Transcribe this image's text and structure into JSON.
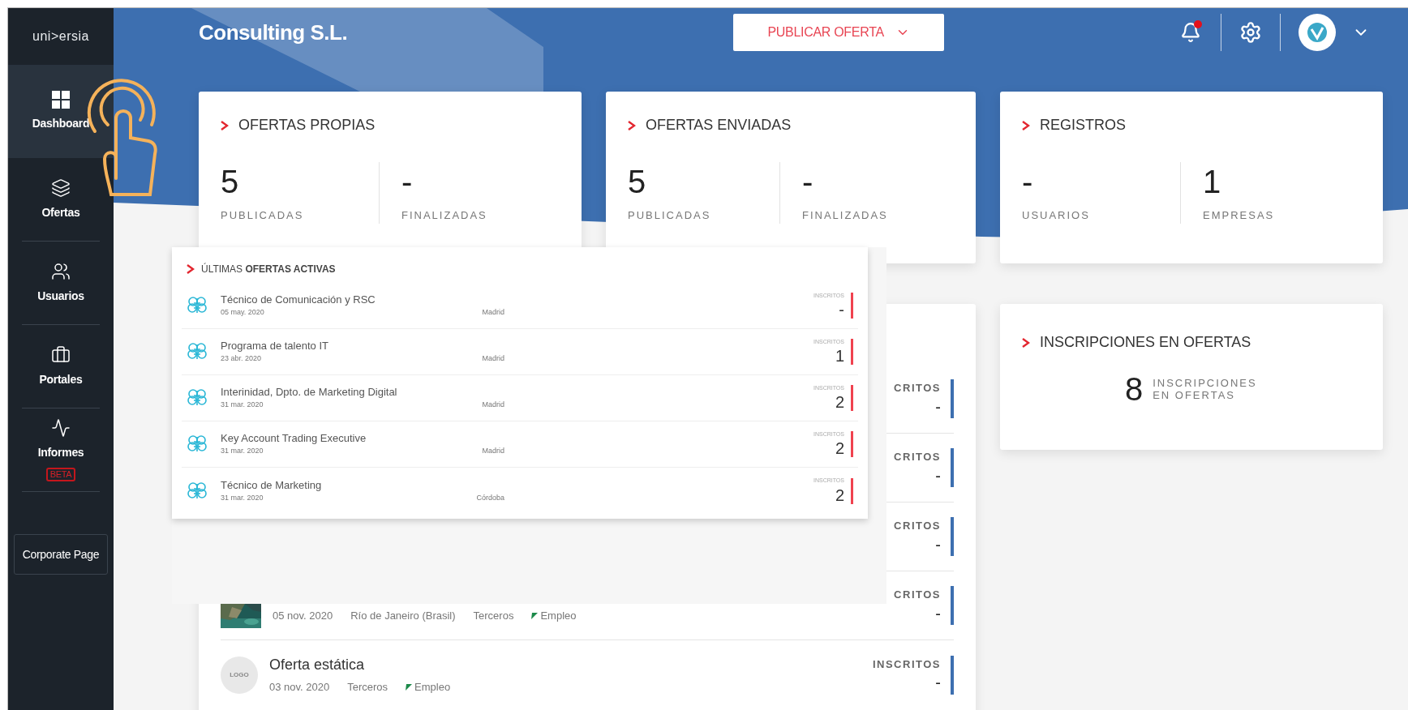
{
  "sidebar": {
    "logo": "uni>ersia",
    "items": [
      {
        "label": "Dashboard",
        "selected": true
      },
      {
        "label": "Ofertas",
        "selected": false
      },
      {
        "label": "Usuarios",
        "selected": false
      },
      {
        "label": "Portales",
        "selected": false
      },
      {
        "label": "Informes",
        "selected": false,
        "badge": "BETA"
      }
    ],
    "corporate_button": "Corporate Page"
  },
  "header": {
    "company": "Consulting S.L.",
    "publish_button": "PUBLICAR OFERTA",
    "unread_notifications": true
  },
  "stat_cards": [
    {
      "title": "OFERTAS PROPIAS",
      "stats": [
        {
          "value": "5",
          "label": "PUBLICADAS"
        },
        {
          "value": "-",
          "label": "FINALIZADAS"
        }
      ]
    },
    {
      "title": "OFERTAS ENVIADAS",
      "stats": [
        {
          "value": "5",
          "label": "PUBLICADAS"
        },
        {
          "value": "-",
          "label": "FINALIZADAS"
        }
      ]
    },
    {
      "title": "REGISTROS",
      "stats": [
        {
          "value": "-",
          "label": "USUARIOS"
        },
        {
          "value": "1",
          "label": "EMPRESAS"
        }
      ]
    }
  ],
  "inscriptions_card": {
    "title": "INSCRIPCIONES EN OFERTAS",
    "value": "8",
    "label": "INSCRIPCIONES EN OFERTAS"
  },
  "offers_list": {
    "rows": [
      {
        "kind": "covered",
        "inscritos_label": "CRITOS",
        "count": "-"
      },
      {
        "kind": "covered",
        "inscritos_label": "CRITOS",
        "count": "-"
      },
      {
        "kind": "covered",
        "inscritos_label": "CRITOS",
        "count": "-"
      },
      {
        "kind": "picture",
        "date": "05 nov. 2020",
        "location": "Río de Janeiro (Brasil)",
        "source": "Terceros",
        "type": "Empleo",
        "inscritos_label": "CRITOS",
        "count": "-"
      },
      {
        "kind": "logo",
        "logo": "LOGO",
        "title": "Oferta estática",
        "date": "03 nov. 2020",
        "source": "Terceros",
        "type": "Empleo",
        "inscritos_label": "INSCRITOS",
        "count": "-"
      }
    ]
  },
  "callout": {
    "title": "ÚLTIMAS **OFERTAS ACTIVAS**",
    "rows": [
      {
        "title": "Técnico de Comunicación y RSC",
        "date": "05 may. 2020",
        "city": "Madrid",
        "inscritos_label": "INSCRITOS",
        "count": "-"
      },
      {
        "title": "Programa de talento IT",
        "date": "23 abr. 2020",
        "city": "Madrid",
        "inscritos_label": "INSCRITOS",
        "count": "1"
      },
      {
        "title": "Interinidad, Dpto. de Marketing Digital",
        "date": "31 mar. 2020",
        "city": "Madrid",
        "inscritos_label": "INSCRITOS",
        "count": "2"
      },
      {
        "title": "Key Account Trading Executive",
        "date": "31 mar. 2020",
        "city": "Madrid",
        "inscritos_label": "INSCRITOS",
        "count": "2"
      },
      {
        "title": "Técnico de Marketing",
        "date": "31 mar. 2020",
        "city": "Córdoba",
        "inscritos_label": "INSCRITOS",
        "count": "2"
      }
    ]
  }
}
